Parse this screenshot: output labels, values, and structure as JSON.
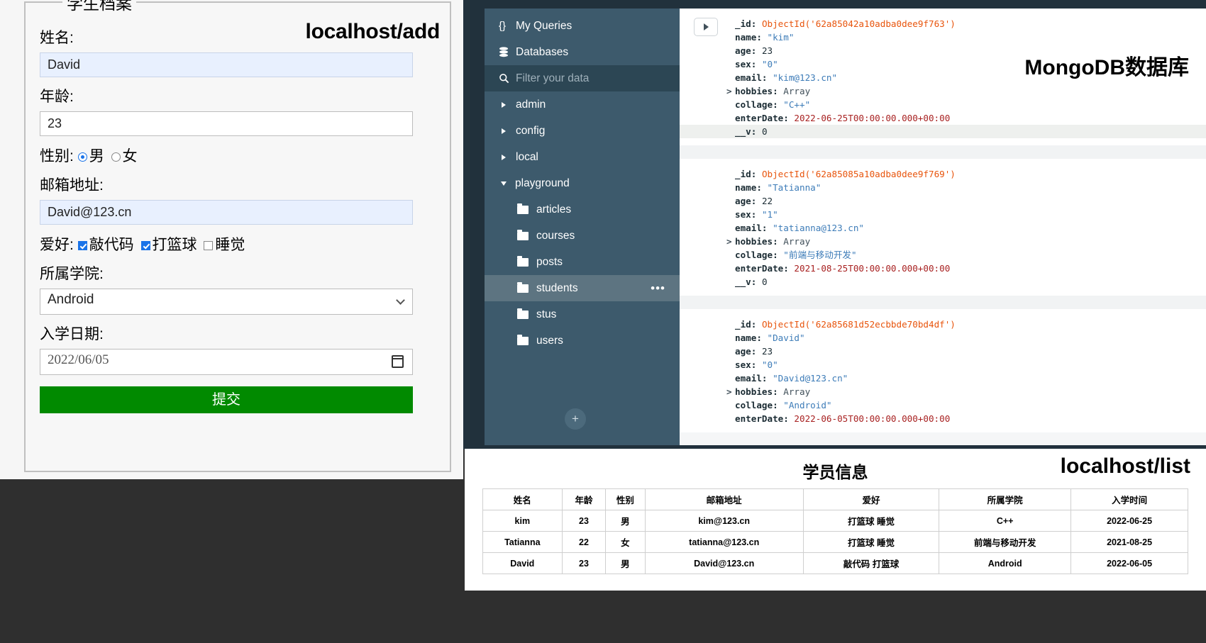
{
  "form": {
    "legend": "学生档案",
    "url_label": "localhost/add",
    "fields": {
      "name_label": "姓名:",
      "name_value": "David",
      "age_label": "年龄:",
      "age_value": "23",
      "sex_label": "性别:",
      "sex_options": [
        {
          "label": "男",
          "checked": true
        },
        {
          "label": "女",
          "checked": false
        }
      ],
      "email_label": "邮箱地址:",
      "email_value": "David@123.cn",
      "hobby_label": "爱好:",
      "hobby_options": [
        {
          "label": "敲代码",
          "checked": true
        },
        {
          "label": "打篮球",
          "checked": true
        },
        {
          "label": "睡觉",
          "checked": false
        }
      ],
      "collage_label": "所属学院:",
      "collage_value": "Android",
      "date_label": "入学日期:",
      "date_value": "2022/06/05"
    },
    "submit_label": "提交",
    "submit_color": "#018a00"
  },
  "compass": {
    "title_overlay": "MongoDB数据库",
    "sidebar": {
      "items": [
        {
          "label": "My Queries",
          "icon": "{}"
        },
        {
          "label": "Databases",
          "icon": "database-icon"
        }
      ],
      "filter_placeholder": "Filter your data",
      "databases": [
        {
          "label": "admin",
          "expanded": false
        },
        {
          "label": "config",
          "expanded": false
        },
        {
          "label": "local",
          "expanded": false
        },
        {
          "label": "playground",
          "expanded": true
        }
      ],
      "collections": [
        {
          "label": "articles",
          "active": false
        },
        {
          "label": "courses",
          "active": false
        },
        {
          "label": "posts",
          "active": false
        },
        {
          "label": "students",
          "active": true
        },
        {
          "label": "stus",
          "active": false
        },
        {
          "label": "users",
          "active": false
        }
      ],
      "add_button": "+"
    },
    "documents": [
      {
        "_id": "ObjectId('62a85042a10adba0dee9f763')",
        "name": "\"kim\"",
        "age": "23",
        "sex": "\"0\"",
        "email": "\"kim@123.cn\"",
        "hobbies": "Array",
        "collage": "\"C++\"",
        "enterDate": "2022-06-25T00:00:00.000+00:00",
        "__v": "0"
      },
      {
        "_id": "ObjectId('62a85085a10adba0dee9f769')",
        "name": "\"Tatianna\"",
        "age": "22",
        "sex": "\"1\"",
        "email": "\"tatianna@123.cn\"",
        "hobbies": "Array",
        "collage": "\"前端与移动开发\"",
        "enterDate": "2021-08-25T00:00:00.000+00:00",
        "__v": "0"
      },
      {
        "_id": "ObjectId('62a85681d52ecbbde70bd4df')",
        "name": "\"David\"",
        "age": "23",
        "sex": "\"0\"",
        "email": "\"David@123.cn\"",
        "hobbies": "Array",
        "collage": "\"Android\"",
        "enterDate": "2022-06-05T00:00:00.000+00:00",
        "__v": "0"
      }
    ],
    "keys": {
      "_id": "_id:",
      "name": "name:",
      "age": "age:",
      "sex": "sex:",
      "email": "email:",
      "hobbies": "hobbies:",
      "collage": "collage:",
      "enterDate": "enterDate:",
      "__v": "__v:"
    }
  },
  "list": {
    "title": "学员信息",
    "url_label": "localhost/list",
    "columns": [
      "姓名",
      "年龄",
      "性别",
      "邮箱地址",
      "爱好",
      "所属学院",
      "入学时间"
    ],
    "rows": [
      [
        "kim",
        "23",
        "男",
        "kim@123.cn",
        "打篮球 睡觉",
        "C++",
        "2022-06-25"
      ],
      [
        "Tatianna",
        "22",
        "女",
        "tatianna@123.cn",
        "打篮球 睡觉",
        "前端与移动开发",
        "2021-08-25"
      ],
      [
        "David",
        "23",
        "男",
        "David@123.cn",
        "敲代码 打篮球",
        "Android",
        "2022-06-05"
      ]
    ]
  }
}
